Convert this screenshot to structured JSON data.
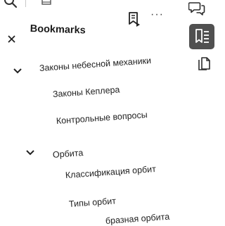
{
  "panel": {
    "title": "Bookmarks",
    "more_label": "···"
  },
  "bookmarks": [
    {
      "label": "Законы небесной механики",
      "expanded": true
    },
    {
      "label": "Законы Кеплера"
    },
    {
      "label": "Контрольные вопросы"
    },
    {
      "label": "Орбита",
      "expanded": true
    },
    {
      "label": "Классификация орбит"
    },
    {
      "label": "Типы орбит"
    },
    {
      "label": "бразная орбита"
    }
  ],
  "colors": {
    "accent_rail_bg": "#505050",
    "text": "#222222",
    "background": "#ffffff"
  },
  "icons": {
    "search": "search-icon",
    "thumbnails": "thumbnails-icon",
    "comments": "comment-icon",
    "bookmarks": "bookmark-panel-icon",
    "copy": "copy-icon",
    "close": "close-icon",
    "add_bookmark": "add-bookmark-icon",
    "expand": "chevron-down-icon"
  }
}
